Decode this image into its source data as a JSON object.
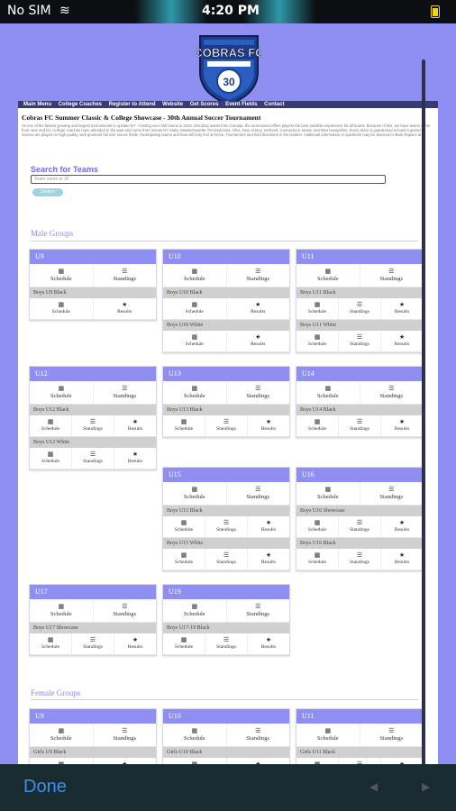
{
  "status": {
    "carrier": "No SIM",
    "time": "4:20 PM"
  },
  "logo": {
    "name": "COBRAS FC",
    "badge": "30"
  },
  "nav": [
    "Main Menu",
    "College Coaches",
    "Register to Attend",
    "Website",
    "Get Scores",
    "Event Fields",
    "Contact"
  ],
  "page_title": "Cobras FC Summer Classic & College Showcase - 30th Annual Soccer Tournament",
  "blurb": "As one of the fastest growing and largest tournaments in upstate NY - hosting over 250 teams in 2019, including teams from Canada, the tournament offers players the best possible experience for all teams. Because of this, we have teams come from near and far. College coaches have attended in the past and come from across NY State, Massachusetts, Pennsylvania, Ohio, New Jersey, Vermont, Connecticut, Maine and New Hampshire. Every team is guaranteed at least 3 games. Games are played on high quality, well groomed full size soccer fields. Participating teams and fans will truly feel at home. Tournament and field directions in the booklet. Additional information or questions may be directed to Mark Rapacz at tournament@cobrasfc.org",
  "search": {
    "title": "Search for Teams",
    "placeholder": "Team name or ID",
    "button": "Search"
  },
  "labels": {
    "schedule": "Schedule",
    "standings": "Standings",
    "results": "Results"
  },
  "male_title": "Male Groups",
  "female_title": "Female Groups",
  "male_groups": [
    {
      "name": "U9",
      "teams": [
        {
          "name": "Boys U9 Black",
          "links": [
            "schedule",
            "results"
          ]
        }
      ]
    },
    {
      "name": "U10",
      "teams": [
        {
          "name": "Boys U10 Black",
          "links": [
            "schedule",
            "results"
          ]
        },
        {
          "name": "Boys U10 White",
          "links": [
            "schedule",
            "results"
          ]
        }
      ]
    },
    {
      "name": "U11",
      "teams": [
        {
          "name": "Boys U11 Black",
          "links": [
            "schedule",
            "standings",
            "results"
          ]
        },
        {
          "name": "Boys U11 White",
          "links": [
            "schedule",
            "standings",
            "results"
          ]
        }
      ]
    },
    {
      "name": "U12",
      "teams": [
        {
          "name": "Boys U12 Black",
          "links": [
            "schedule",
            "standings",
            "results"
          ]
        },
        {
          "name": "Boys U12 White",
          "links": [
            "schedule",
            "standings",
            "results"
          ]
        }
      ]
    },
    {
      "name": "U13",
      "teams": [
        {
          "name": "Boys U13 Black",
          "links": [
            "schedule",
            "standings",
            "results"
          ]
        }
      ]
    },
    {
      "name": "U14",
      "teams": [
        {
          "name": "Boys U14 Black",
          "links": [
            "schedule",
            "standings",
            "results"
          ]
        }
      ]
    },
    {
      "name": "U15",
      "teams": [
        {
          "name": "Boys U15 Black",
          "links": [
            "schedule",
            "standings",
            "results"
          ]
        },
        {
          "name": "Boys U15 White",
          "links": [
            "schedule",
            "standings",
            "results"
          ]
        }
      ]
    },
    {
      "name": "U16",
      "teams": [
        {
          "name": "Boys U16 Showcase",
          "links": [
            "schedule",
            "standings",
            "results"
          ]
        },
        {
          "name": "Boys U16 Black",
          "links": [
            "schedule",
            "standings",
            "results"
          ]
        }
      ]
    },
    {
      "name": "U17",
      "teams": [
        {
          "name": "Boys U17 Showcase",
          "links": [
            "schedule",
            "standings",
            "results"
          ]
        }
      ]
    },
    {
      "name": "U19",
      "teams": [
        {
          "name": "Boys U17-19 Black",
          "links": [
            "schedule",
            "standings",
            "results"
          ]
        }
      ]
    }
  ],
  "female_groups": [
    {
      "name": "U9",
      "teams": [
        {
          "name": "Girls U9 Black",
          "links": [
            "schedule",
            "results"
          ]
        }
      ]
    },
    {
      "name": "U10",
      "teams": [
        {
          "name": "Girls U10 Black",
          "links": [
            "schedule",
            "results"
          ]
        }
      ]
    },
    {
      "name": "U11",
      "teams": [
        {
          "name": "Girls U11 Black",
          "links": [
            "schedule",
            "standings",
            "results"
          ]
        }
      ]
    }
  ],
  "toolbar": {
    "done": "Done",
    "back": "◀",
    "forward": "▶"
  },
  "colors": {
    "accent": "#8f8ef3",
    "nav": "#373b78",
    "done": "#3b8ff5"
  }
}
